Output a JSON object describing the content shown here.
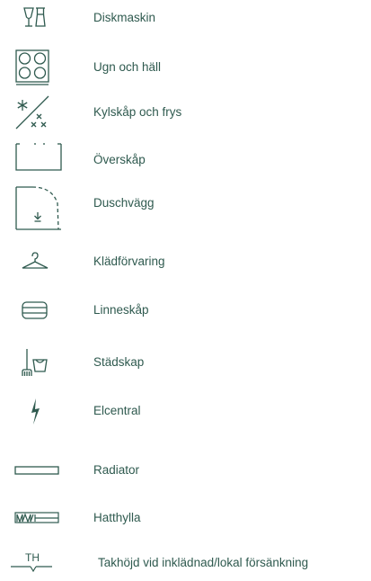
{
  "colors": {
    "accent": "#2f5a4f"
  },
  "legend": {
    "items": [
      {
        "icon": "dishwasher-icon",
        "label": "Diskmaskin"
      },
      {
        "icon": "stove-oven-icon",
        "label": "Ugn och häll"
      },
      {
        "icon": "fridge-freezer-icon",
        "label": "Kylskåp och frys"
      },
      {
        "icon": "upper-cabinet-icon",
        "label": "Överskåp"
      },
      {
        "icon": "shower-wall-icon",
        "label": "Duschvägg"
      },
      {
        "icon": "hanger-icon",
        "label": "Klädförvaring"
      },
      {
        "icon": "linen-cabinet-icon",
        "label": "Linneskåp"
      },
      {
        "icon": "cleaning-cupboard-icon",
        "label": "Städskap"
      },
      {
        "icon": "electric-panel-icon",
        "label": "Elcentral"
      },
      {
        "icon": "radiator-icon",
        "label": "Radiator"
      },
      {
        "icon": "hat-shelf-icon",
        "label": "Hatthylla"
      },
      {
        "icon": "ceiling-height-icon",
        "icon_text": "TH",
        "label": "Takhöjd vid inklädnad/lokal försänkning"
      }
    ]
  }
}
